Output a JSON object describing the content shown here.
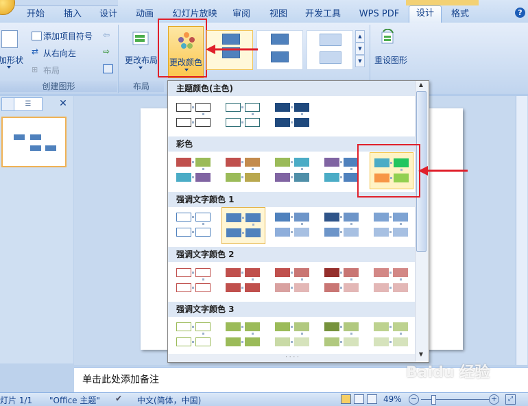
{
  "ribbon_tabs": [
    "开始",
    "插入",
    "设计",
    "动画",
    "幻灯片放映",
    "审阅",
    "视图",
    "开发工具",
    "WPS PDF",
    "设计",
    "格式"
  ],
  "active_tab": "设计",
  "create_graphic": {
    "add_bullet": "添加项目符号",
    "right_to_left": "从右向左",
    "layout": "布局",
    "add_shape": "添加形状",
    "group_label": "创建图形"
  },
  "layouts": {
    "change_layout": "更改布局",
    "group_label": "布局"
  },
  "change_colors": "更改颜色",
  "reset_graphic": "重设图形",
  "dropdown": {
    "sections": [
      {
        "title": "主题颜色(主色)",
        "palettes": [
          [
            "#ffffff",
            "#ffffff",
            "#ffffff",
            "#ffffff",
            "outline-dark"
          ],
          [
            "#ffffff",
            "#ffffff",
            "#ffffff",
            "#ffffff",
            "outline-teal"
          ],
          [
            "#1f497d",
            "#1f497d",
            "#1f497d",
            "#1f497d",
            "fill"
          ]
        ]
      },
      {
        "title": "彩色",
        "palettes": [
          [
            "#c0504d",
            "#9bbb59",
            "#4bacc6",
            "#8064a2",
            "fill"
          ],
          [
            "#c0504d",
            "#c38b4d",
            "#9bbb59",
            "#b9a84e",
            "fill"
          ],
          [
            "#9bbb59",
            "#4bacc6",
            "#8064a2",
            "#4f8fa8",
            "fill"
          ],
          [
            "#8064a2",
            "#4f81bd",
            "#4bacc6",
            "#4f81bd",
            "fill"
          ],
          [
            "#4bacc6",
            "#22c55e",
            "#f79646",
            "#92d050",
            "fill"
          ]
        ]
      },
      {
        "title": "强调文字颜色 1",
        "palettes": [
          [
            "#ffffff",
            "#ffffff",
            "#ffffff",
            "#ffffff",
            "outline-blue"
          ],
          [
            "#4f81bd",
            "#4f81bd",
            "#4f81bd",
            "#4f81bd",
            "fill"
          ],
          [
            "#4f81bd",
            "#6d95c9",
            "#8eaedb",
            "#a7c0e2",
            "fill"
          ],
          [
            "#2f5489",
            "#6d95c9",
            "#6d95c9",
            "#a7c0e2",
            "fill"
          ],
          [
            "#7ea3d3",
            "#7ea3d3",
            "#a7c0e2",
            "#a7c0e2",
            "fill"
          ]
        ]
      },
      {
        "title": "强调文字颜色 2",
        "palettes": [
          [
            "#ffffff",
            "#ffffff",
            "#ffffff",
            "#ffffff",
            "outline-red"
          ],
          [
            "#c0504d",
            "#c0504d",
            "#c0504d",
            "#c0504d",
            "fill"
          ],
          [
            "#c0504d",
            "#c97674",
            "#d9a1a0",
            "#e3b7b6",
            "fill"
          ],
          [
            "#952f2c",
            "#c97674",
            "#c97674",
            "#e3b7b6",
            "fill"
          ],
          [
            "#d38886",
            "#d38886",
            "#e3b7b6",
            "#e3b7b6",
            "fill"
          ]
        ]
      },
      {
        "title": "强调文字颜色 3",
        "palettes": [
          [
            "#ffffff",
            "#ffffff",
            "#ffffff",
            "#ffffff",
            "outline-green"
          ],
          [
            "#9bbb59",
            "#9bbb59",
            "#9bbb59",
            "#9bbb59",
            "fill"
          ],
          [
            "#9bbb59",
            "#b1c97f",
            "#c9daa6",
            "#d6e3bc",
            "fill"
          ],
          [
            "#76923c",
            "#b1c97f",
            "#b1c97f",
            "#d6e3bc",
            "fill"
          ],
          [
            "#bdd28f",
            "#bdd28f",
            "#d6e3bc",
            "#d6e3bc",
            "fill"
          ]
        ]
      }
    ]
  },
  "notes_placeholder": "单击此处添加备注",
  "status": {
    "slide": "灯片 1/1",
    "theme": "\"Office 主题\"",
    "language": "中文(简体，中国)",
    "zoom": "49%"
  },
  "watermark": "Baidu 经验"
}
